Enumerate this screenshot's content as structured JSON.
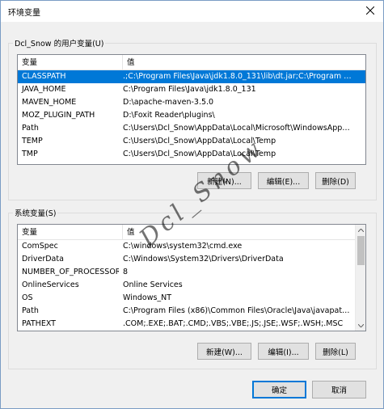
{
  "window": {
    "title": "环境变量",
    "close_icon": "close-icon"
  },
  "user_vars": {
    "group_label": "Dcl_Snow 的用户变量(U)",
    "columns": [
      "变量",
      "值"
    ],
    "rows": [
      {
        "name": "CLASSPATH",
        "value": ".;C:\\Program Files\\Java\\jdk1.8.0_131\\lib\\dt.jar;C:\\Program File...",
        "selected": true
      },
      {
        "name": "JAVA_HOME",
        "value": "C:\\Program Files\\Java\\jdk1.8.0_131"
      },
      {
        "name": "MAVEN_HOME",
        "value": "D:\\apache-maven-3.5.0"
      },
      {
        "name": "MOZ_PLUGIN_PATH",
        "value": "D:\\Foxit Reader\\plugins\\"
      },
      {
        "name": "Path",
        "value": "C:\\Users\\Dcl_Snow\\AppData\\Local\\Microsoft\\WindowsApps;\"..."
      },
      {
        "name": "TEMP",
        "value": "C:\\Users\\Dcl_Snow\\AppData\\Local\\Temp"
      },
      {
        "name": "TMP",
        "value": "C:\\Users\\Dcl_Snow\\AppData\\Local\\Temp"
      }
    ],
    "buttons": {
      "new": "新建(N)...",
      "edit": "编辑(E)...",
      "delete": "删除(D)"
    }
  },
  "system_vars": {
    "group_label": "系统变量(S)",
    "columns": [
      "变量",
      "值"
    ],
    "rows": [
      {
        "name": "ComSpec",
        "value": "C:\\windows\\system32\\cmd.exe"
      },
      {
        "name": "DriverData",
        "value": "C:\\Windows\\System32\\Drivers\\DriverData"
      },
      {
        "name": "NUMBER_OF_PROCESSORS",
        "value": "8"
      },
      {
        "name": "OnlineServices",
        "value": "Online Services"
      },
      {
        "name": "OS",
        "value": "Windows_NT"
      },
      {
        "name": "Path",
        "value": "C:\\Program Files (x86)\\Common Files\\Oracle\\Java\\javapath;C:..."
      },
      {
        "name": "PATHEXT",
        "value": ".COM;.EXE;.BAT;.CMD;.VBS;.VBE;.JS;.JSE;.WSF;.WSH;.MSC"
      }
    ],
    "buttons": {
      "new": "新建(W)...",
      "edit": "编辑(I)...",
      "delete": "删除(L)"
    }
  },
  "footer": {
    "ok": "确定",
    "cancel": "取消"
  },
  "watermark": "Dcl_Snow"
}
